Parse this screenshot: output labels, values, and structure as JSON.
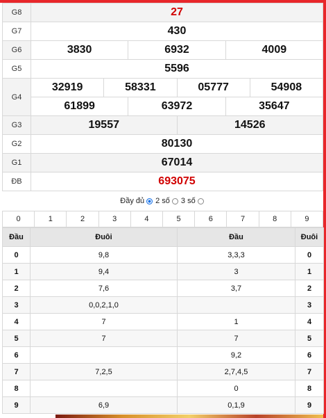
{
  "prizes": {
    "g8": {
      "label": "G8",
      "value": "27"
    },
    "g7": {
      "label": "G7",
      "value": "430"
    },
    "g6": {
      "label": "G6",
      "values": [
        "3830",
        "6932",
        "4009"
      ]
    },
    "g5": {
      "label": "G5",
      "value": "5596"
    },
    "g4": {
      "label": "G4",
      "row1": [
        "32919",
        "58331",
        "05777",
        "54908"
      ],
      "row2": [
        "61899",
        "63972",
        "35647"
      ]
    },
    "g3": {
      "label": "G3",
      "values": [
        "19557",
        "14526"
      ]
    },
    "g2": {
      "label": "G2",
      "value": "80130"
    },
    "g1": {
      "label": "G1",
      "value": "67014"
    },
    "db": {
      "label": "ĐB",
      "value": "693075"
    }
  },
  "options": {
    "full_label": "Đầy đủ",
    "two_label": "2 số",
    "three_label": "3 số",
    "selected": "full"
  },
  "digits": [
    "0",
    "1",
    "2",
    "3",
    "4",
    "5",
    "6",
    "7",
    "8",
    "9"
  ],
  "loto": {
    "headers": {
      "dau": "Đầu",
      "duoi": "Đuôi",
      "dau2": "Đầu",
      "duoi2": "Đuôi"
    },
    "rows": [
      {
        "k": "0",
        "tails": "9,8",
        "heads": "3,3,3",
        "k2": "0"
      },
      {
        "k": "1",
        "tails": "9,4",
        "heads": "3",
        "k2": "1"
      },
      {
        "k": "2",
        "tails": "7,6",
        "heads": "3,7",
        "k2": "2"
      },
      {
        "k": "3",
        "tails": "0,0,2,1,0",
        "heads": "",
        "k2": "3"
      },
      {
        "k": "4",
        "tails": "7",
        "heads": "1",
        "k2": "4"
      },
      {
        "k": "5",
        "tails": "7",
        "heads": "7",
        "k2": "5"
      },
      {
        "k": "6",
        "tails": "",
        "heads": "9,2",
        "k2": "6"
      },
      {
        "k": "7",
        "tails": "7,2,5",
        "heads": "2,7,4,5",
        "k2": "7"
      },
      {
        "k": "8",
        "tails": "",
        "heads": "0",
        "k2": "8"
      },
      {
        "k": "9",
        "tails": "6,9",
        "heads": "0,1,9",
        "k2": "9"
      }
    ]
  },
  "colors": {
    "accent": "#e8262a",
    "special": "#d10000",
    "radio": "#1a73e8"
  }
}
